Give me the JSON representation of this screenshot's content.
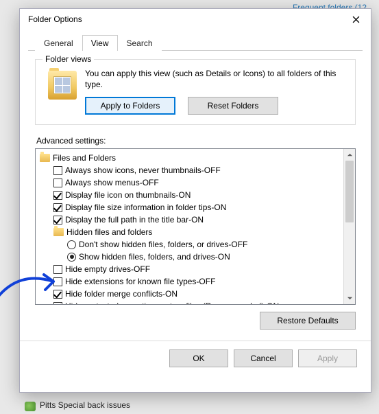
{
  "bg": {
    "frequent_link": "Frequent folders (12",
    "bottom_item": "Pitts Special back issues"
  },
  "dialog": {
    "title": "Folder Options",
    "tabs": [
      "General",
      "View",
      "Search"
    ],
    "active_tab_index": 1,
    "folder_views": {
      "legend": "Folder views",
      "desc": "You can apply this view (such as Details or Icons) to all folders of this type.",
      "apply_btn": "Apply to Folders",
      "reset_btn": "Reset Folders"
    },
    "advanced_label": "Advanced settings:",
    "tree": {
      "root": "Files and Folders",
      "items": [
        {
          "type": "check",
          "checked": false,
          "label": "Always show icons, never thumbnails-OFF"
        },
        {
          "type": "check",
          "checked": false,
          "label": "Always show menus-OFF"
        },
        {
          "type": "check",
          "checked": true,
          "label": "Display file icon on thumbnails-ON"
        },
        {
          "type": "check",
          "checked": true,
          "label": "Display file size information in folder tips-ON"
        },
        {
          "type": "check",
          "checked": true,
          "label": "Display the full path in the title bar-ON"
        },
        {
          "type": "folder",
          "label": "Hidden files and folders"
        },
        {
          "type": "radio",
          "checked": false,
          "label": "Don't show hidden files, folders, or drives-OFF"
        },
        {
          "type": "radio",
          "checked": true,
          "label": "Show hidden files, folders, and drives-ON"
        },
        {
          "type": "check",
          "checked": false,
          "label": "Hide empty drives-OFF"
        },
        {
          "type": "check",
          "checked": false,
          "label": "Hide extensions for known file types-OFF"
        },
        {
          "type": "check",
          "checked": true,
          "label": "Hide folder merge conflicts-ON"
        },
        {
          "type": "check",
          "checked": true,
          "label": "Hide protected operating system files (Recommended)-ON"
        }
      ]
    },
    "restore_btn": "Restore Defaults",
    "footer": {
      "ok": "OK",
      "cancel": "Cancel",
      "apply": "Apply"
    }
  }
}
